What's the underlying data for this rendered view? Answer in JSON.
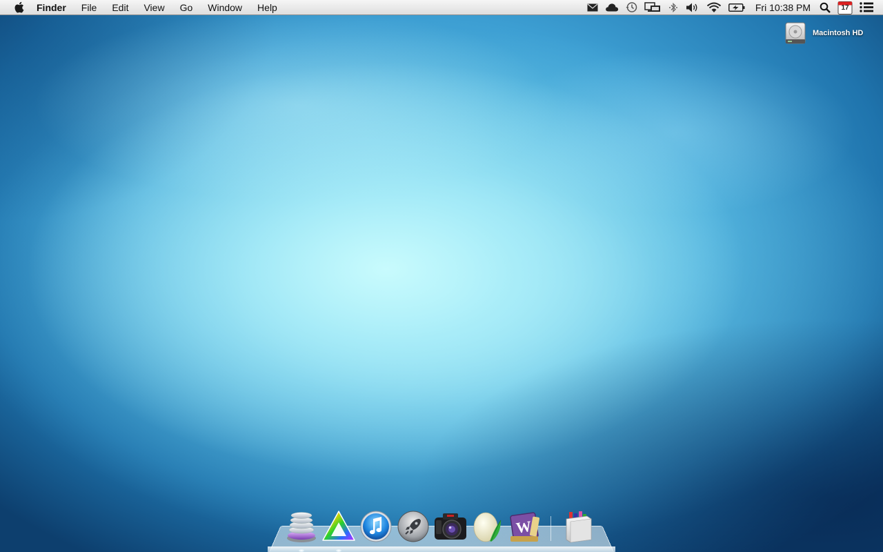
{
  "menubar": {
    "apple_icon": "apple-logo-icon",
    "app_name": "Finder",
    "menus": [
      "File",
      "Edit",
      "View",
      "Go",
      "Window",
      "Help"
    ],
    "status_icons": [
      "mail-icon",
      "cloud-icon",
      "time-machine-icon",
      "display-mirroring-icon",
      "bluetooth-icon",
      "volume-icon",
      "wifi-icon",
      "battery-icon"
    ],
    "clock": "Fri 10:38 PM",
    "calendar_day": "17",
    "right_icons": [
      "spotlight-icon",
      "calendar-icon",
      "notification-center-icon"
    ]
  },
  "desktop": {
    "drive_label": "Macintosh HD",
    "drive_icon": "hard-drive-icon"
  },
  "dock": {
    "items": [
      {
        "name": "stack-app-icon",
        "running": true
      },
      {
        "name": "prism-app-icon",
        "running": true
      },
      {
        "name": "itunes-icon",
        "running": false
      },
      {
        "name": "launchpad-icon",
        "running": false
      },
      {
        "name": "camera-app-icon",
        "running": false
      },
      {
        "name": "egg-feather-app-icon",
        "running": false
      },
      {
        "name": "wordpress-app-icon",
        "running": false
      }
    ],
    "trailing_items": [
      {
        "name": "applications-folder-icon"
      }
    ]
  },
  "colors": {
    "menubar_bg": "#e9e9e9",
    "wallpaper_center": "#c8fbfd",
    "wallpaper_edge": "#0d3f6e"
  }
}
